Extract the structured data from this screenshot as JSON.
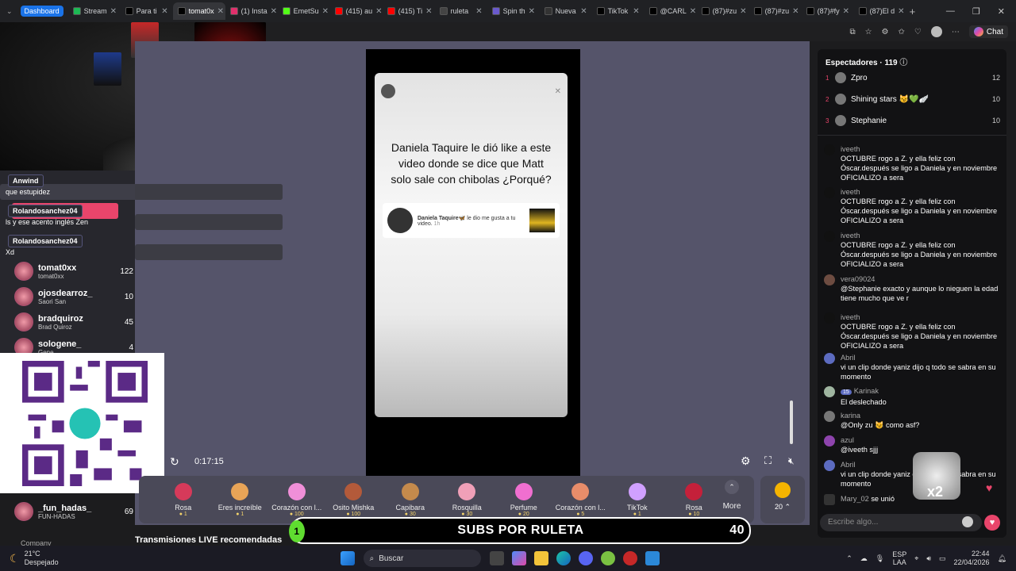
{
  "browser": {
    "dashboard_label": "Dashboard",
    "tabs": [
      {
        "label": "Stream",
        "color": "#1db954"
      },
      {
        "label": "Para ti",
        "color": "#000000"
      },
      {
        "label": "tomat0x",
        "color": "#000000"
      },
      {
        "label": "(1) Insta",
        "color": "#e1306c"
      },
      {
        "label": "EmetSu",
        "color": "#53fc18"
      },
      {
        "label": "(415) au",
        "color": "#ff0000"
      },
      {
        "label": "(415) Ti",
        "color": "#ff0000"
      },
      {
        "label": "ruleta",
        "color": "#444444"
      },
      {
        "label": "Spin th",
        "color": "#6a5acd"
      },
      {
        "label": "Nueva",
        "color": "#333333"
      },
      {
        "label": "TikTok",
        "color": "#000000"
      },
      {
        "label": "@CARL",
        "color": "#000000"
      },
      {
        "label": "(87)#zu",
        "color": "#000000"
      },
      {
        "label": "(87)#zu",
        "color": "#000000"
      },
      {
        "label": "(87)#fy",
        "color": "#000000"
      },
      {
        "label": "(87)El d",
        "color": "#000000"
      }
    ],
    "chat_button": "Chat"
  },
  "overlay": {
    "chat": [
      {
        "user": "Anwind",
        "text": "que estupidez"
      },
      {
        "user": "Rolandosanchez04",
        "text": "ls y ese acento inglés Zen"
      },
      {
        "user": "Rolandosanchez04",
        "text": "Xd"
      }
    ],
    "leaderboard": [
      {
        "name": "tomat0xx",
        "sub": "tomat0xx",
        "count": "122"
      },
      {
        "name": "ojosdearroz_",
        "sub": "Saori San",
        "count": "10"
      },
      {
        "name": "bradquiroz",
        "sub": "Brad Quiroz",
        "count": "45"
      },
      {
        "name": "sologene_",
        "sub": "Gene",
        "count": "4"
      },
      {
        "name": "_fun_hadas_",
        "sub": "FUN-HADAS",
        "count": "69"
      }
    ],
    "company": "Company",
    "recommended": "Transmisiones LIVE recomendadas"
  },
  "video": {
    "story_text": "Daniela Taquire le dió like a este video donde se dice que Matt solo sale con chibolas ¿Porqué?",
    "card_name": "Daniela Taquire🦋",
    "card_text": "le dio me gusta a tu video.",
    "card_time": "1h",
    "timestamp": "0:17:15"
  },
  "gifts": [
    {
      "name": "Rosa",
      "price": "1",
      "color": "#d63a5a"
    },
    {
      "name": "Eres increíble",
      "price": "1",
      "color": "#e8a457"
    },
    {
      "name": "Corazón con l...",
      "price": "100",
      "color": "#f08fd8"
    },
    {
      "name": "Osito Mishka",
      "price": "100",
      "color": "#b35a3a"
    },
    {
      "name": "Capibara",
      "price": "30",
      "color": "#c48a4c"
    },
    {
      "name": "Rosquilla",
      "price": "30",
      "color": "#f0a0b8"
    },
    {
      "name": "Perfume",
      "price": "20",
      "color": "#f06fd0"
    },
    {
      "name": "Corazón con l...",
      "price": "5",
      "color": "#e88d6a"
    },
    {
      "name": "TikTok",
      "price": "1",
      "color": "#d0a0ff"
    },
    {
      "name": "Rosa",
      "price": "10",
      "color": "#c4203a"
    }
  ],
  "more_label": "More",
  "coin_label": "20",
  "subs_banner": {
    "badge": "1",
    "text": "SUBS POR RULETA",
    "count": "40"
  },
  "right_panel": {
    "header": "Espectadores · 119",
    "top": [
      {
        "rank": "1",
        "name": "Zpro",
        "count": "12"
      },
      {
        "rank": "2",
        "name": "Shining stars 😼💚🪽",
        "count": "10"
      },
      {
        "rank": "3",
        "name": "Stephanie",
        "count": "10"
      }
    ],
    "messages": [
      {
        "user": "iveeth",
        "text": "OCTUBRE rogo a Z. y ella feliz con Óscar.después se ligo a Daniela y en noviembre OFICIALIZO a sera"
      },
      {
        "user": "iveeth",
        "text": "OCTUBRE rogo a Z. y ella feliz con Óscar.después se ligo a Daniela y en noviembre OFICIALIZO a sera"
      },
      {
        "user": "iveeth",
        "text": "OCTUBRE rogo a Z. y ella feliz con Óscar.después se ligo a Daniela y en noviembre OFICIALIZO a sera"
      },
      {
        "user": "vera09024",
        "text": "@Stephanie exacto y aunque lo nieguen la edad tiene mucho que ve r"
      },
      {
        "user": "iveeth",
        "text": "OCTUBRE rogo a Z. y ella feliz con Óscar.después se ligo a Daniela y en noviembre OFICIALIZO a sera"
      },
      {
        "user": "Abril",
        "text": "vi un clip donde yaniz dijo q todo se sabra en su momento"
      },
      {
        "user": "Karinak",
        "text": "El deslechado"
      },
      {
        "user": "karina",
        "text": "@Only zu 😼 como asf?"
      },
      {
        "user": "azul",
        "text": "@iveeth sjjj"
      },
      {
        "user": "Abril",
        "text": "vi un clip donde yaniz dijo q todo se sabra en su momento"
      }
    ],
    "joined": {
      "user": "Mary_02",
      "text": "se unió"
    },
    "badge_level": "15",
    "x2": "x2",
    "input_placeholder": "Escribe algo..."
  },
  "taskbar": {
    "weather_temp": "21°C",
    "weather_desc": "Despejado",
    "search": "Buscar",
    "lang": "ESP",
    "lang2": "LAA",
    "time": "22:44",
    "date": "22/04/2026"
  }
}
